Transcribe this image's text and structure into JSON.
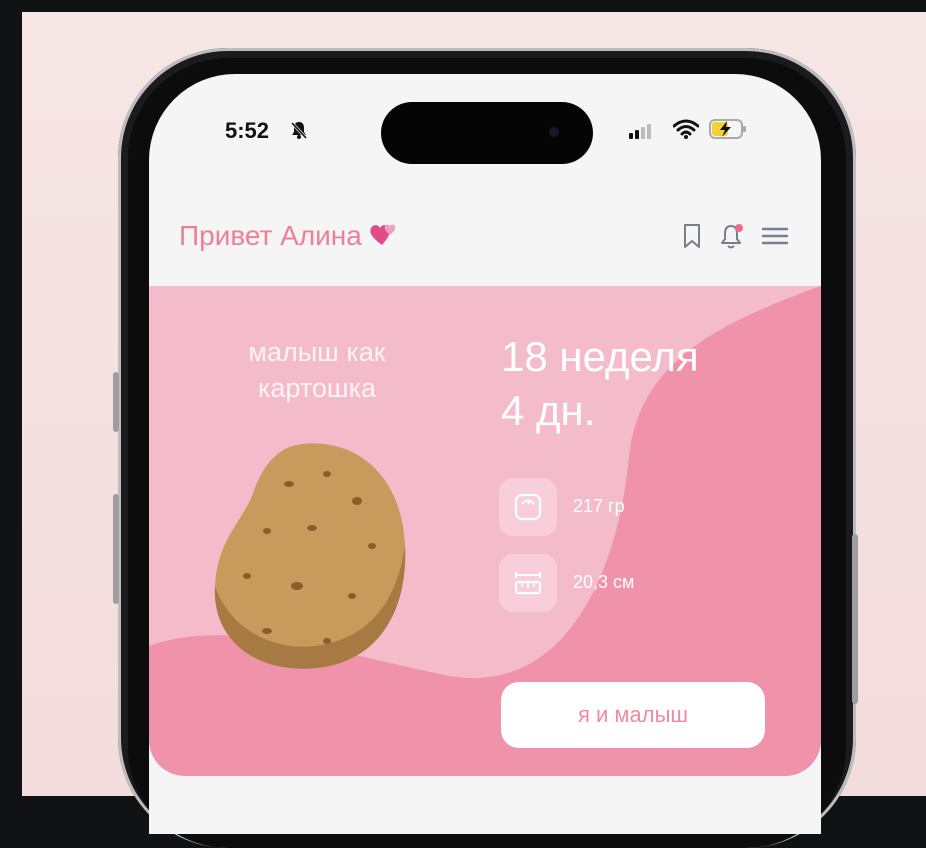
{
  "status_bar": {
    "time": "5:52"
  },
  "header": {
    "greeting": "Привет Алина"
  },
  "card": {
    "fruit_label": "малыш как картошка",
    "week_line1": "18 неделя",
    "week_line2": "4 дн.",
    "weight": "217 гр",
    "length": "20,3 см",
    "cta_label": "я и малыш"
  },
  "colors": {
    "accent": "#ef7f96",
    "card_light": "#f4bccb",
    "card_dark": "#f092aa"
  },
  "icons": [
    "bell-off-icon",
    "signal-icon",
    "wifi-icon",
    "battery-charging-icon",
    "heart-icon",
    "bookmark-icon",
    "notification-bell-icon",
    "menu-icon",
    "scale-icon",
    "ruler-icon",
    "potato-illustration"
  ]
}
